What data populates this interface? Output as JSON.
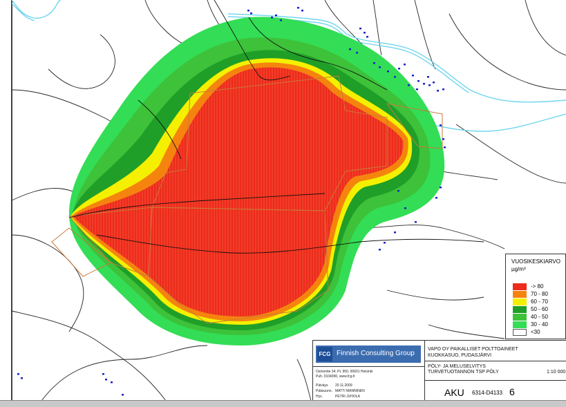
{
  "legend": {
    "title": "VUOSIKESKIARVO",
    "unit": "µg/m³",
    "items": [
      {
        "label": "-> 80",
        "color": "#ee2a1a"
      },
      {
        "label": "70 - 80",
        "color": "#f5840f"
      },
      {
        "label": "60 - 70",
        "color": "#f4f000"
      },
      {
        "label": "50 - 60",
        "color": "#1f9f28"
      },
      {
        "label": "40 - 50",
        "color": "#3dc23a"
      },
      {
        "label": "30 - 40",
        "color": "#33dd55"
      },
      {
        "label": "<30",
        "color": "#ffffff"
      }
    ]
  },
  "company": {
    "logo_text": "FCG",
    "name": "Finnish Consulting Group",
    "address": "Osmontie 34, PL 950, 00601 Helsinki",
    "contact": "Puh. 0104090, www.fcg.fi"
  },
  "signatures": [
    {
      "key": "Päiväys",
      "value": "20.11.2009"
    },
    {
      "key": "Pääsuunn.",
      "value": "MATTI MANNINEN"
    },
    {
      "key": "Hyv.",
      "value": "PETRI JUHOLA"
    }
  ],
  "project": {
    "client": "VAPO OY PAIKALLISET POLTTOAINEET",
    "site": "KUOKKASUO, PUDASJÄRVI",
    "study": "PÖLY- JA MELUSELVITYS",
    "drawing_title": "TURVETUOTANNON TSP PÖLY",
    "scale": "1:10 000",
    "series": "AKU",
    "drawing_number": "6314-D4133",
    "sheet": "6"
  },
  "zones": {
    "z30_40": "#33dd55",
    "z40_50": "#3dc23a",
    "z50_60": "#1f9f28",
    "z60_70": "#f4f000",
    "z70_80": "#f5840f",
    "z80": "#ee2a1a",
    "water": "#6fd6ee",
    "building": "#1a22cc",
    "outline": "#c97a3a"
  }
}
